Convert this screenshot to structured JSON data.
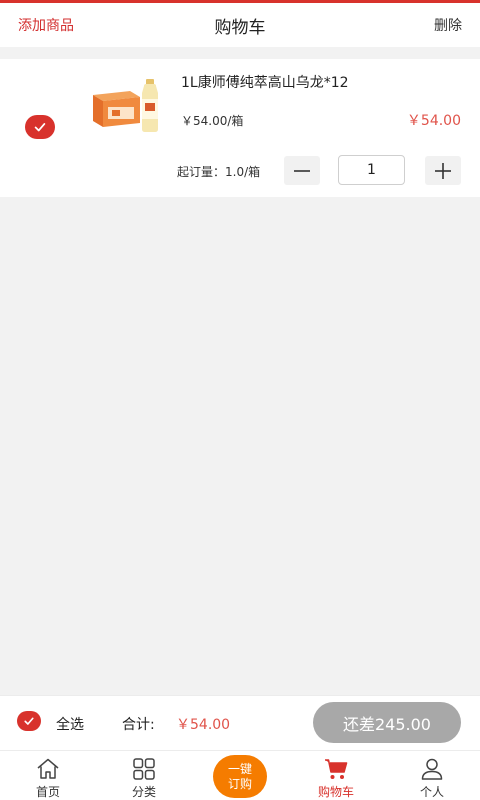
{
  "header": {
    "add_goods": "添加商品",
    "title": "购物车",
    "delete": "删除"
  },
  "cart": {
    "items": [
      {
        "name": "1L康师傅纯萃高山乌龙*12",
        "unit_price": "￥54.00/箱",
        "subtotal": "￥54.00",
        "min_order": "起订量：1.0/箱",
        "quantity": "1",
        "checked": true
      }
    ]
  },
  "summary": {
    "select_all": "全选",
    "total_label": "合计:",
    "total_amount": "￥54.00",
    "shortfall_button": "还差245.00"
  },
  "tabbar": {
    "home": "首页",
    "category": "分类",
    "one_click_line1": "一键",
    "one_click_line2": "订购",
    "cart": "购物车",
    "me": "个人"
  },
  "colors": {
    "accent": "#d8322c",
    "price": "#e0534a",
    "order_button": "#f57c00",
    "disabled_button": "#a8a8a8"
  },
  "icons": {
    "item_check": "check-icon",
    "minus": "minus-icon",
    "plus": "plus-icon",
    "home": "home-icon",
    "category": "grid-icon",
    "cart": "cart-icon",
    "me": "user-icon"
  }
}
